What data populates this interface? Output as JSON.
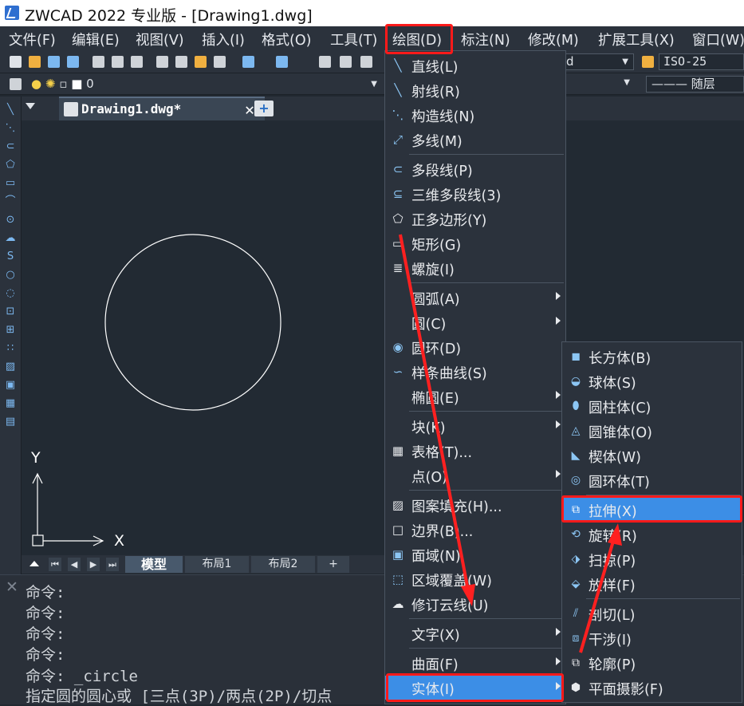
{
  "window": {
    "title": "ZWCAD 2022 专业版 - [Drawing1.dwg]"
  },
  "menubar": [
    {
      "label": "文件(F)"
    },
    {
      "label": "编辑(E)"
    },
    {
      "label": "视图(V)"
    },
    {
      "label": "插入(I)"
    },
    {
      "label": "格式(O)"
    },
    {
      "label": "工具(T)"
    },
    {
      "label": "绘图(D)"
    },
    {
      "label": "标注(N)"
    },
    {
      "label": "修改(M)"
    },
    {
      "label": "扩展工具(X)"
    },
    {
      "label": "窗口(W)"
    }
  ],
  "toolbar": {
    "textstyle_value": "d",
    "dimstyle_value": "ISO-25",
    "layer_value": "0",
    "linetype_value": "——— 随层"
  },
  "document_tab": {
    "label": "Drawing1.dwg*"
  },
  "ucs": {
    "x_label": "X",
    "y_label": "Y"
  },
  "layout_tabs": [
    {
      "label": "模型"
    },
    {
      "label": "布局1"
    },
    {
      "label": "布局2"
    },
    {
      "label": "+"
    }
  ],
  "command_lines": [
    "命令:",
    "命令:",
    "命令:",
    "命令:",
    "命令: _circle",
    "指定圆的圆心或 [三点(3P)/两点(2P)/切点"
  ],
  "draw_menu": {
    "items": [
      {
        "label": "直线(L)",
        "icon": "line-icon"
      },
      {
        "label": "射线(R)",
        "icon": "ray-icon"
      },
      {
        "label": "构造线(N)",
        "icon": "xline-icon"
      },
      {
        "label": "多线(M)",
        "icon": "multiline-icon"
      },
      {
        "label": "多段线(P)",
        "icon": "polyline-icon"
      },
      {
        "label": "三维多段线(3)",
        "icon": "3d-polyline-icon"
      },
      {
        "label": "正多边形(Y)",
        "icon": "polygon-icon"
      },
      {
        "label": "矩形(G)",
        "icon": "rectangle-icon"
      },
      {
        "label": "螺旋(I)",
        "icon": "helix-icon"
      },
      {
        "label": "圆弧(A)",
        "icon": ""
      },
      {
        "label": "圆(C)",
        "icon": ""
      },
      {
        "label": "圆环(D)",
        "icon": "donut-icon"
      },
      {
        "label": "样条曲线(S)",
        "icon": "spline-icon"
      },
      {
        "label": "椭圆(E)",
        "icon": ""
      },
      {
        "label": "块(K)",
        "icon": ""
      },
      {
        "label": "表格(T)...",
        "icon": "table-icon"
      },
      {
        "label": "点(O)",
        "icon": ""
      },
      {
        "label": "图案填充(H)...",
        "icon": "hatch-icon"
      },
      {
        "label": "边界(B)...",
        "icon": "boundary-icon"
      },
      {
        "label": "面域(N)",
        "icon": "region-icon"
      },
      {
        "label": "区域覆盖(W)",
        "icon": "wipeout-icon"
      },
      {
        "label": "修订云线(U)",
        "icon": "revcloud-icon"
      },
      {
        "label": "文字(X)",
        "icon": ""
      },
      {
        "label": "曲面(F)",
        "icon": ""
      },
      {
        "label": "实体(I)",
        "icon": ""
      }
    ]
  },
  "solid_menu": {
    "items": [
      {
        "label": "长方体(B)",
        "icon": "box-icon"
      },
      {
        "label": "球体(S)",
        "icon": "sphere-icon"
      },
      {
        "label": "圆柱体(C)",
        "icon": "cylinder-icon"
      },
      {
        "label": "圆锥体(O)",
        "icon": "cone-icon"
      },
      {
        "label": "楔体(W)",
        "icon": "wedge-icon"
      },
      {
        "label": "圆环体(T)",
        "icon": "torus-icon"
      },
      {
        "label": "拉伸(X)",
        "icon": "extrude-icon"
      },
      {
        "label": "旋转(R)",
        "icon": "revolve-icon"
      },
      {
        "label": "扫掠(P)",
        "icon": "sweep-icon"
      },
      {
        "label": "放样(F)",
        "icon": "loft-icon"
      },
      {
        "label": "剖切(L)",
        "icon": "slice-icon"
      },
      {
        "label": "干涉(I)",
        "icon": "interfere-icon"
      },
      {
        "label": "轮廓(P)",
        "icon": "profile-icon"
      },
      {
        "label": "平面摄影(F)",
        "icon": "flatshot-icon"
      }
    ]
  },
  "colors": {
    "highlight": "#3c8ee6",
    "annotation_red": "#ff1a1a",
    "canvas": "#222a33",
    "menu_bg": "#2b323c"
  }
}
